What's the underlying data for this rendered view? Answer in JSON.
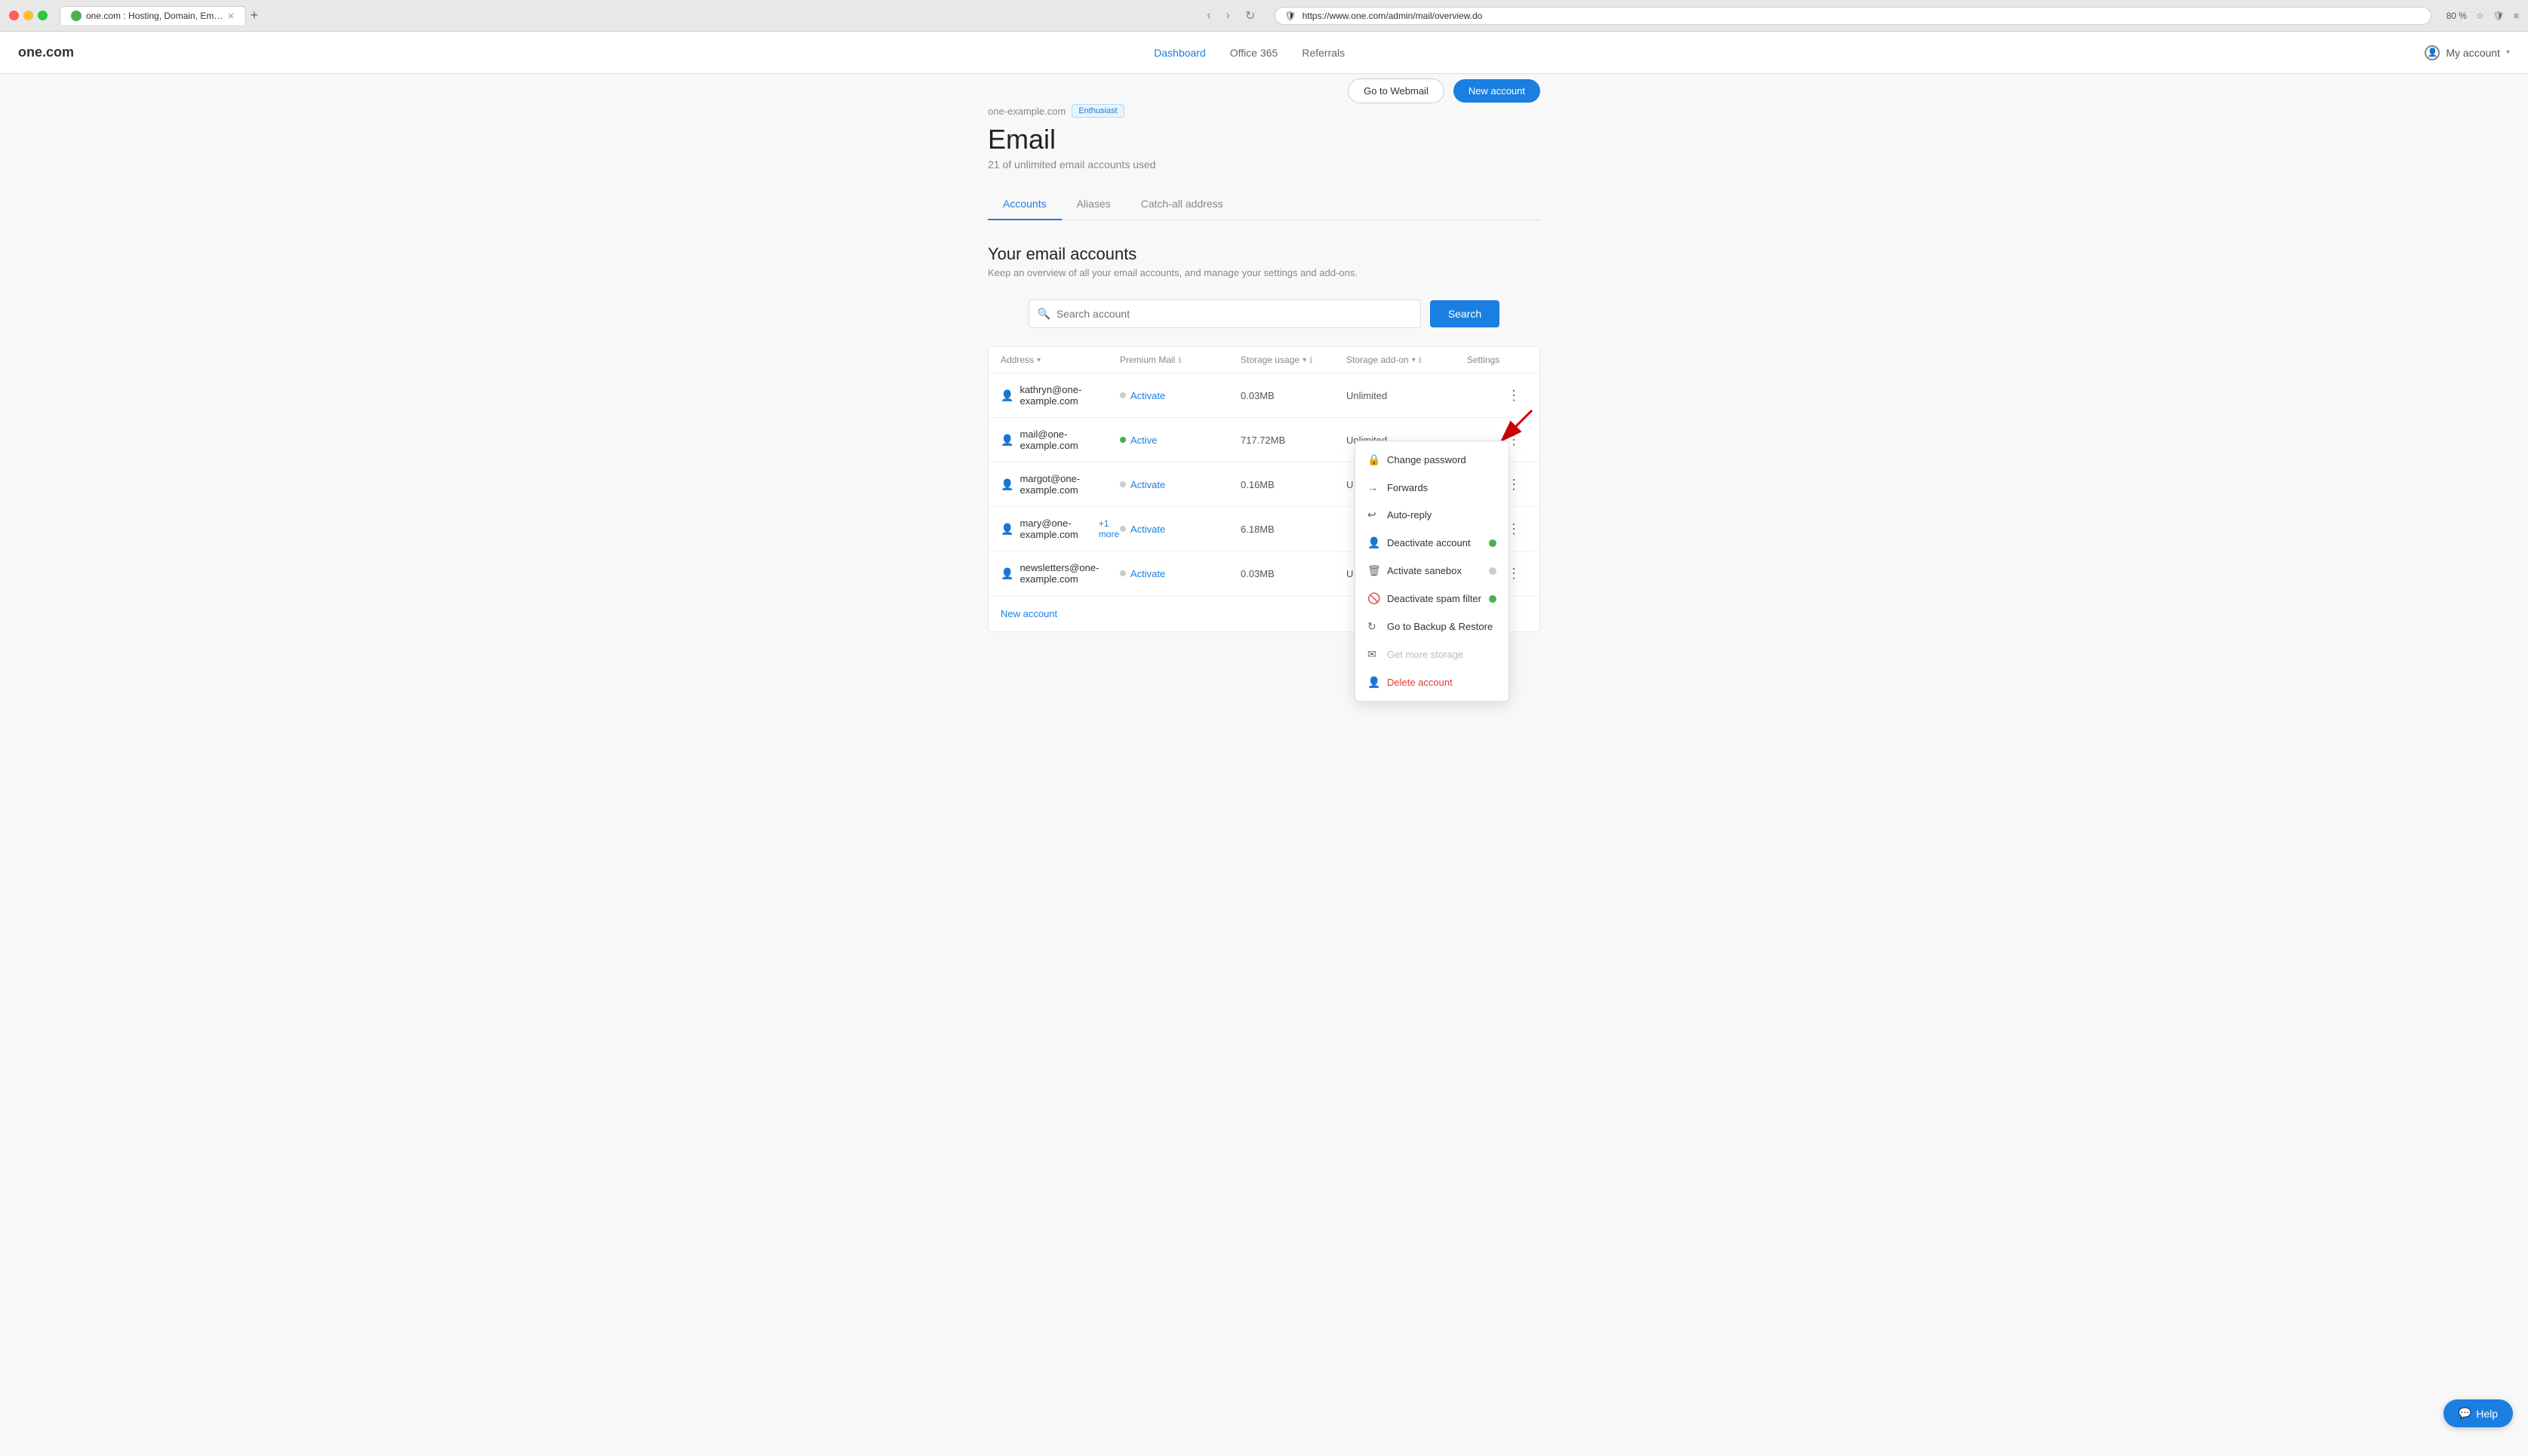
{
  "browser": {
    "tab_title": "one.com : Hosting, Domain, Em…",
    "url": "https://www.one.com/admin/mail/overview.do",
    "zoom": "80 %",
    "new_tab_label": "+"
  },
  "header": {
    "logo": "one.com",
    "nav": [
      {
        "label": "Dashboard",
        "active": true
      },
      {
        "label": "Office 365",
        "active": false
      },
      {
        "label": "Referrals",
        "active": false
      }
    ],
    "my_account": "My account"
  },
  "domain": {
    "name": "one-example.com",
    "badge": "Enthusiast"
  },
  "page": {
    "title": "Email",
    "subtitle": "21 of unlimited email accounts used",
    "go_to_webmail": "Go to Webmail",
    "new_account": "New account"
  },
  "tabs": [
    {
      "label": "Accounts",
      "active": true
    },
    {
      "label": "Aliases",
      "active": false
    },
    {
      "label": "Catch-all address",
      "active": false
    }
  ],
  "section": {
    "title": "Your email accounts",
    "subtitle": "Keep an overview of all your email accounts, and manage your settings and add-ons."
  },
  "search": {
    "placeholder": "Search account",
    "button": "Search"
  },
  "table": {
    "headers": [
      {
        "label": "Address",
        "sortable": true
      },
      {
        "label": "Premium Mail",
        "info": true
      },
      {
        "label": "Storage usage",
        "sortable": true,
        "info": true
      },
      {
        "label": "Storage add-on",
        "sortable": true,
        "info": true
      },
      {
        "label": "Settings"
      }
    ],
    "rows": [
      {
        "email": "kathryn@one-example.com",
        "premium_status": "Activate",
        "premium_active": false,
        "storage": "0.03MB",
        "addon": "Unlimited",
        "has_menu": false
      },
      {
        "email": "mail@one-example.com",
        "premium_status": "Active",
        "premium_active": true,
        "storage": "717.72MB",
        "addon": "Unlimited",
        "has_menu": true,
        "menu_open": true
      },
      {
        "email": "margot@one-example.com",
        "premium_status": "Activate",
        "premium_active": false,
        "storage": "0.16MB",
        "addon": "U",
        "has_menu": false
      },
      {
        "email": "mary@one-example.com",
        "extra": "+1 more",
        "premium_status": "Activate",
        "premium_active": false,
        "storage": "6.18MB",
        "addon": "",
        "has_menu": false
      },
      {
        "email": "newsletters@one-example.com",
        "premium_status": "Activate",
        "premium_active": false,
        "storage": "0.03MB",
        "addon": "U",
        "has_menu": false
      }
    ],
    "new_account_link": "New account"
  },
  "context_menu": {
    "items": [
      {
        "label": "Change password",
        "icon": "🔒",
        "type": "normal",
        "toggle": null
      },
      {
        "label": "Forwards",
        "icon": "→",
        "type": "normal",
        "toggle": null
      },
      {
        "label": "Auto-reply",
        "icon": "↩",
        "type": "normal",
        "toggle": null
      },
      {
        "label": "Deactivate account",
        "icon": "👤",
        "type": "normal",
        "toggle": "on"
      },
      {
        "label": "Activate sanebox",
        "icon": "🗑",
        "type": "normal",
        "toggle": "off"
      },
      {
        "label": "Deactivate spam filter",
        "icon": "🚫",
        "type": "normal",
        "toggle": "on"
      },
      {
        "label": "Go to Backup & Restore",
        "icon": "↻",
        "type": "normal",
        "toggle": null
      },
      {
        "label": "Get more storage",
        "icon": "✉",
        "type": "disabled",
        "toggle": null
      },
      {
        "label": "Delete account",
        "icon": "👤",
        "type": "danger",
        "toggle": null
      }
    ]
  },
  "help": {
    "label": "Help"
  }
}
